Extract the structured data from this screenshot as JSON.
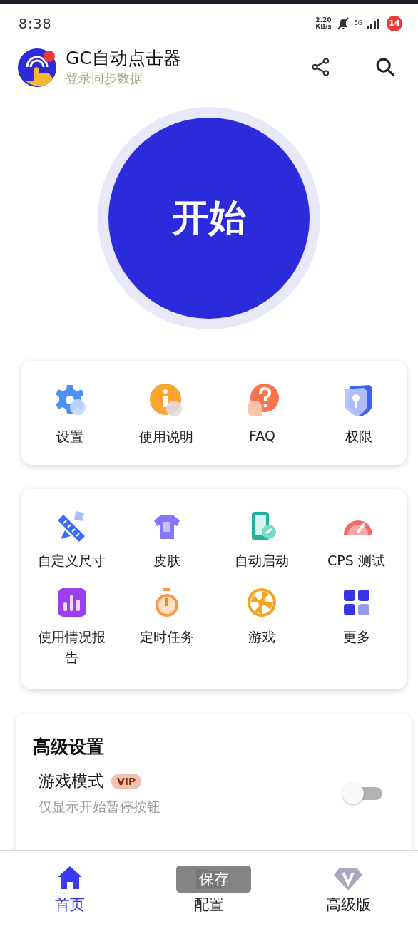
{
  "status_bar": {
    "time": "8:38",
    "net_speed_value": "2.20",
    "net_speed_unit": "KB/s",
    "network": "5G",
    "notification_count": "14"
  },
  "header": {
    "title": "GC自动点击器",
    "subtitle": "登录同步数据"
  },
  "start_button": {
    "label": "开始"
  },
  "quick_actions": [
    {
      "label": "设置"
    },
    {
      "label": "使用说明"
    },
    {
      "label": "FAQ"
    },
    {
      "label": "权限"
    }
  ],
  "tools": [
    {
      "label": "自定义尺寸"
    },
    {
      "label": "皮肤"
    },
    {
      "label": "自动启动"
    },
    {
      "label": "CPS 测试"
    },
    {
      "label": "使用情况报告"
    },
    {
      "label": "定时任务"
    },
    {
      "label": "游戏"
    },
    {
      "label": "更多"
    }
  ],
  "advanced": {
    "title": "高级设置",
    "settings": [
      {
        "label": "游戏模式",
        "badge": "VIP",
        "description": "仅显示开始暂停按钮",
        "on": false
      }
    ]
  },
  "bottom_nav": [
    {
      "label": "首页",
      "selected": true
    },
    {
      "label": "配置",
      "selected": false
    },
    {
      "label": "高级版",
      "selected": false
    }
  ],
  "toast": {
    "text": "保存"
  }
}
